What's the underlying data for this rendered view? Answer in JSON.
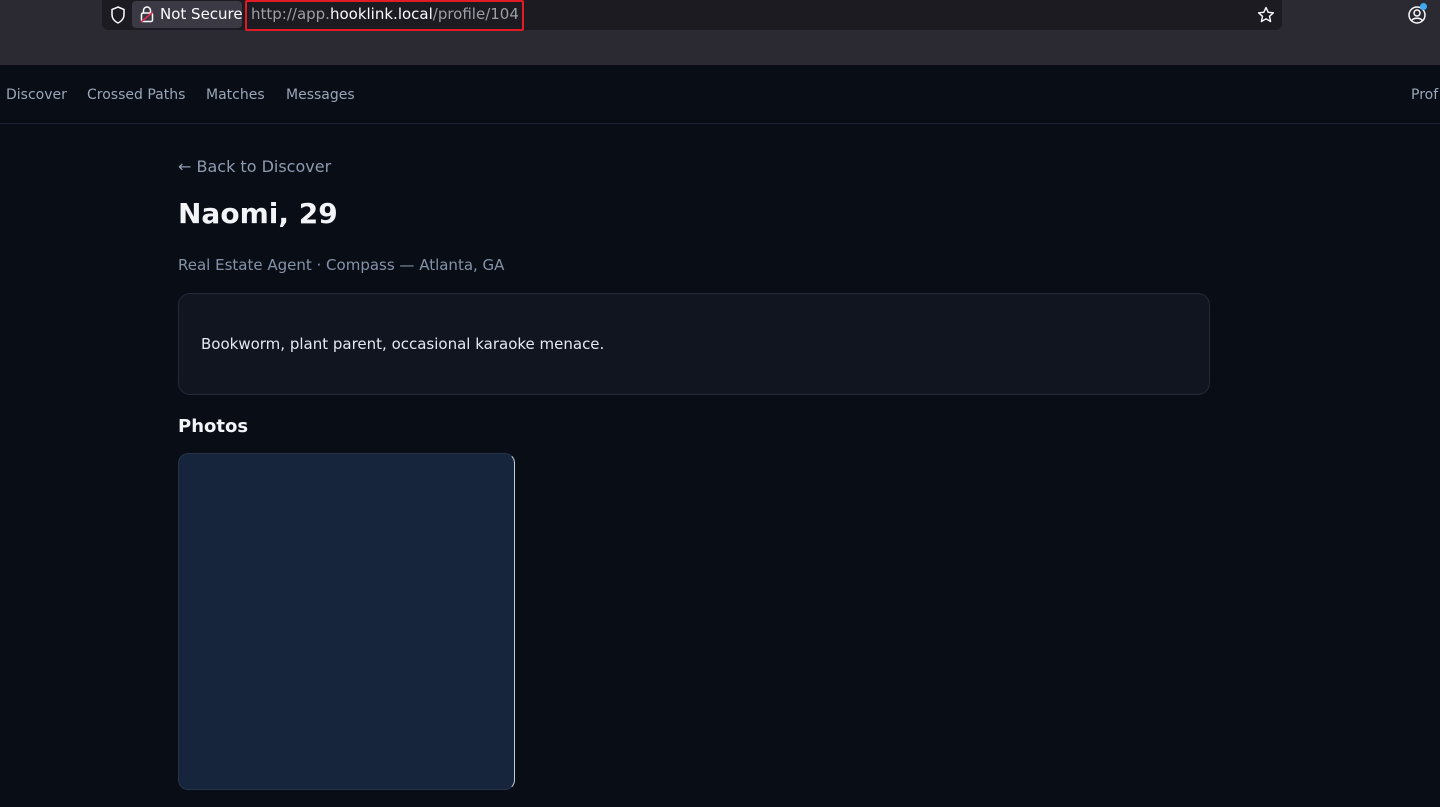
{
  "browser": {
    "security_label": "Not Secure",
    "url_scheme": "http://app.",
    "url_host": "hooklink.local",
    "url_path": "/profile/104"
  },
  "nav": {
    "items": [
      "Discover",
      "Crossed Paths",
      "Matches",
      "Messages"
    ],
    "profile_label": "Prof"
  },
  "profile": {
    "back_label": "← Back to Discover",
    "name_age": "Naomi, 29",
    "subtitle": "Real Estate Agent · Compass — Atlanta, GA",
    "bio": "Bookworm, plant parent, occasional karaoke menace.",
    "photos_heading": "Photos"
  },
  "colors": {
    "background": "#090d16",
    "url_highlight": "#e01b24",
    "photo_placeholder": "#16253c"
  },
  "icons": [
    "shield-icon",
    "lock-icon",
    "star-icon",
    "account-icon"
  ]
}
